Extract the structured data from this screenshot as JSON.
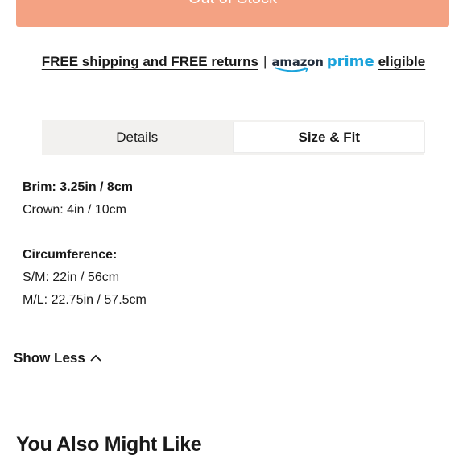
{
  "cta": {
    "label": "Out of Stock"
  },
  "shipping": {
    "text": "FREE shipping and FREE returns",
    "separator": "|",
    "amazon_word": "amazon",
    "prime_word": "prime",
    "eligible": "eligible"
  },
  "tabs": [
    {
      "label": "Details",
      "active": false
    },
    {
      "label": "Size & Fit",
      "active": true
    }
  ],
  "size_fit": {
    "brim": "Brim: 3.25in / 8cm",
    "crown": "Crown: 4in / 10cm",
    "circumference_label": "Circumference:",
    "sm": "S/M: 22in / 56cm",
    "ml": "M/L: 22.75in / 57.5cm"
  },
  "show_less": "Show Less",
  "recommend_title": "You Also Might Like",
  "colors": {
    "cta_bg": "#f4a283",
    "prime_blue": "#1ba3db",
    "tab_bg": "#f2f1ef"
  },
  "icons": [
    "chevron-up-icon",
    "amazon-smile-icon"
  ]
}
